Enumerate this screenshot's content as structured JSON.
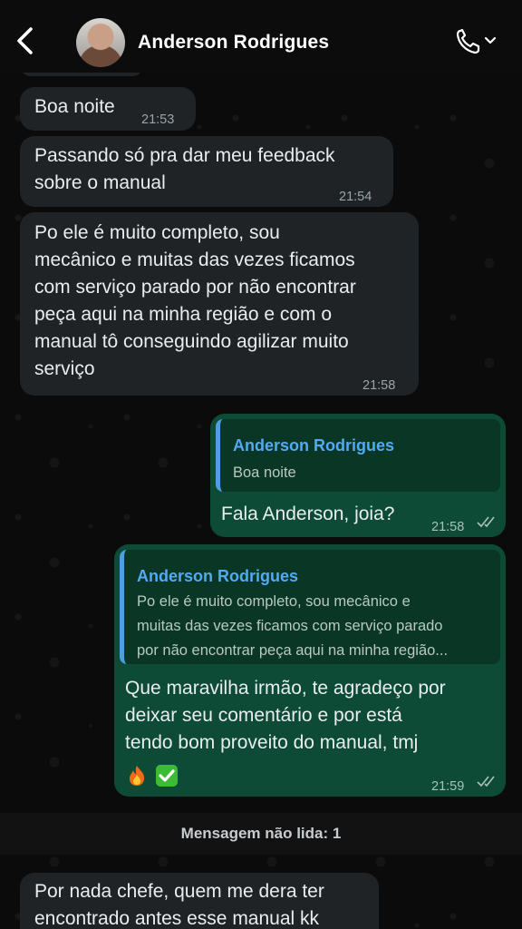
{
  "header": {
    "contact_name": "Anderson Rodrigues",
    "back_icon": "chevron-left-icon",
    "call_icon": "phone-icon"
  },
  "messages": [
    {
      "direction": "in",
      "text": "Boa noite",
      "time": "21:53"
    },
    {
      "direction": "in",
      "text_lines": [
        "Passando só pra dar meu feedback",
        "sobre o manual"
      ],
      "time": "21:54"
    },
    {
      "direction": "in",
      "text_lines": [
        "Po ele é muito completo, sou",
        "mecânico e muitas das vezes ficamos",
        "com serviço parado por não encontrar",
        "peça aqui na minha região e com o",
        "manual tô conseguindo agilizar muito",
        "serviço"
      ],
      "time": "21:58"
    },
    {
      "direction": "out",
      "reply_name": "Anderson Rodrigues",
      "reply_text": "Boa noite",
      "text": "Fala Anderson, joia?",
      "time": "21:58"
    },
    {
      "direction": "out",
      "reply_name": "Anderson Rodrigues",
      "reply_lines": [
        "Po ele é muito completo, sou mecânico e",
        "muitas das vezes ficamos com serviço parado",
        "por não encontrar peça aqui na minha região..."
      ],
      "text_lines": [
        "Que maravilha irmão, te agradeço por",
        "deixar seu comentário e por está",
        "tendo bom proveito do manual, tmj"
      ],
      "emojis": [
        "fire-emoji",
        "check-mark-emoji"
      ],
      "time": "21:59"
    },
    {
      "direction": "in",
      "text_lines": [
        "Por nada chefe, quem me dera ter",
        "encontrado antes esse manual kk"
      ]
    }
  ],
  "unread_label": "Mensagem não lida: 1",
  "colors": {
    "incoming_bubble": "#1f2326",
    "outgoing_bubble": "#0d4b36",
    "reply_accent": "#53a9f3"
  }
}
